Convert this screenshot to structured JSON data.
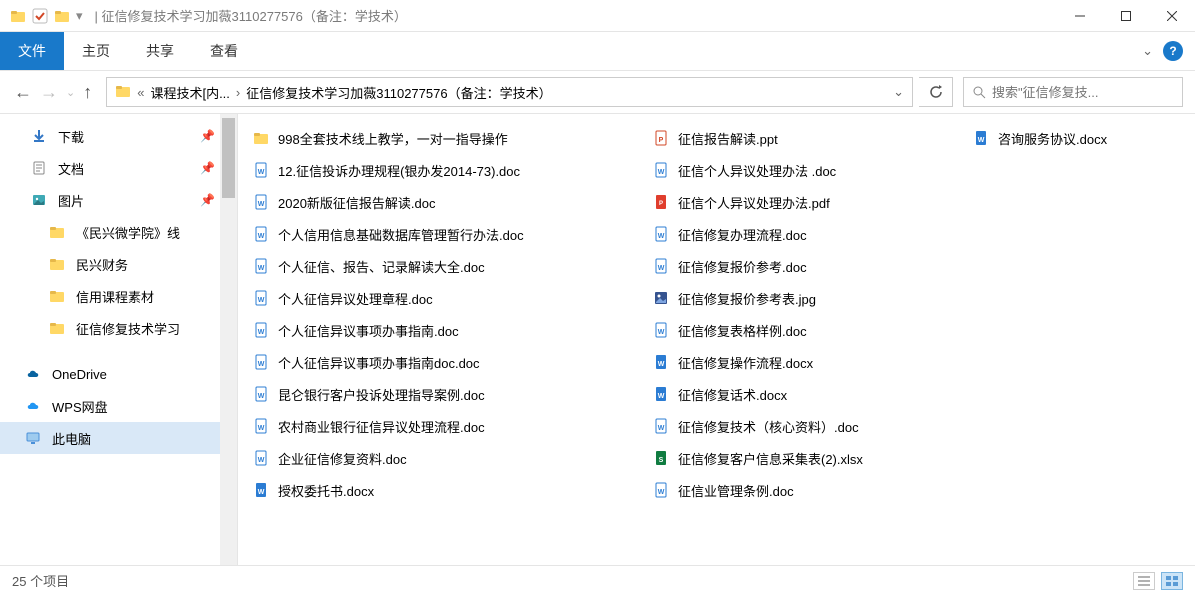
{
  "titlebar": {
    "title": "| 征信修复技术学习加薇3110277576（备注：学技术）"
  },
  "ribbon": {
    "file": "文件",
    "tabs": [
      "主页",
      "共享",
      "查看"
    ]
  },
  "address": {
    "seg1_prefix": "«",
    "seg1": "课程技术[内...",
    "seg2": "征信修复技术学习加薇3110277576（备注：学技术）"
  },
  "search": {
    "placeholder": "搜索\"征信修复技..."
  },
  "sidebar": {
    "items": [
      {
        "label": "下载",
        "icon": "download",
        "pinned": true
      },
      {
        "label": "文档",
        "icon": "doc",
        "pinned": true
      },
      {
        "label": "图片",
        "icon": "pic",
        "pinned": true
      },
      {
        "label": "《民兴微学院》线",
        "icon": "folder",
        "indent": true
      },
      {
        "label": "民兴财务",
        "icon": "folder",
        "indent": true
      },
      {
        "label": "信用课程素材",
        "icon": "folder",
        "indent": true
      },
      {
        "label": "征信修复技术学习",
        "icon": "folder",
        "indent": true
      },
      {
        "label": "OneDrive",
        "icon": "onedrive",
        "root": true
      },
      {
        "label": "WPS网盘",
        "icon": "wps",
        "root": true
      },
      {
        "label": "此电脑",
        "icon": "pc",
        "root": true,
        "sel": true
      }
    ]
  },
  "files_col1": [
    {
      "name": "998全套技术线上教学，一对一指导操作",
      "type": "folder"
    },
    {
      "name": "12.征信投诉办理规程(银办发2014-73).doc",
      "type": "doc"
    },
    {
      "name": "2020新版征信报告解读.doc",
      "type": "doc"
    },
    {
      "name": "个人信用信息基础数据库管理暂行办法.doc",
      "type": "doc"
    },
    {
      "name": "个人征信、报告、记录解读大全.doc",
      "type": "doc"
    },
    {
      "name": "个人征信异议处理章程.doc",
      "type": "doc"
    },
    {
      "name": "个人征信异议事项办事指南.doc",
      "type": "doc"
    },
    {
      "name": "个人征信异议事项办事指南doc.doc",
      "type": "doc"
    },
    {
      "name": "昆仑银行客户投诉处理指导案例.doc",
      "type": "doc"
    },
    {
      "name": "农村商业银行征信异议处理流程.doc",
      "type": "doc"
    },
    {
      "name": "企业征信修复资料.doc",
      "type": "doc"
    },
    {
      "name": "授权委托书.docx",
      "type": "docx"
    }
  ],
  "files_col2": [
    {
      "name": "征信报告解读.ppt",
      "type": "ppt"
    },
    {
      "name": "征信个人异议处理办法 .doc",
      "type": "doc"
    },
    {
      "name": "征信个人异议处理办法.pdf",
      "type": "pdf"
    },
    {
      "name": "征信修复办理流程.doc",
      "type": "doc"
    },
    {
      "name": "征信修复报价参考.doc",
      "type": "doc"
    },
    {
      "name": "征信修复报价参考表.jpg",
      "type": "jpg"
    },
    {
      "name": "征信修复表格样例.doc",
      "type": "doc"
    },
    {
      "name": "征信修复操作流程.docx",
      "type": "docx"
    },
    {
      "name": "征信修复话术.docx",
      "type": "docx"
    },
    {
      "name": "征信修复技术（核心资料）.doc",
      "type": "doc"
    },
    {
      "name": "征信修复客户信息采集表(2).xlsx",
      "type": "xlsx"
    },
    {
      "name": "征信业管理条例.doc",
      "type": "doc"
    }
  ],
  "files_col3": [
    {
      "name": "咨询服务协议.docx",
      "type": "docx"
    }
  ],
  "status": {
    "count": "25 个项目"
  }
}
